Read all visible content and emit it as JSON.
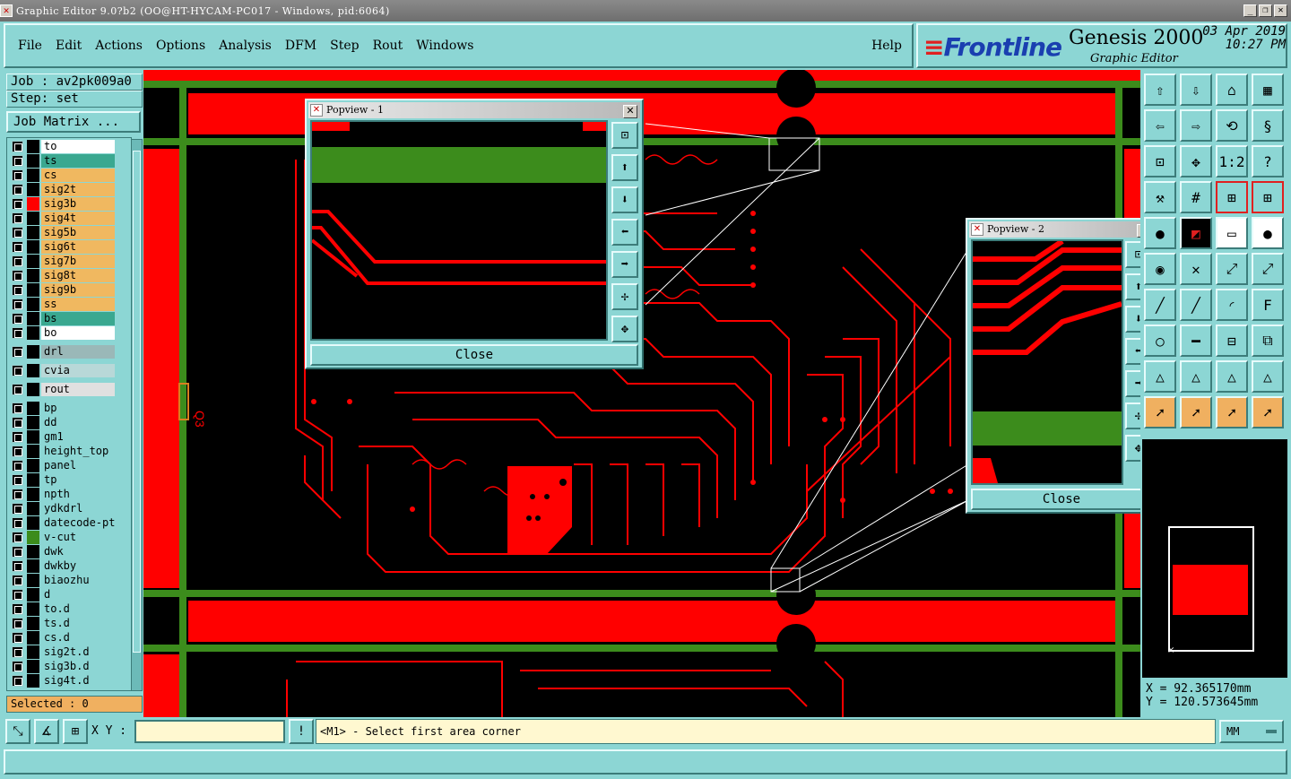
{
  "window": {
    "title": "Graphic Editor 9.0?b2 (OO@HT-HYCAM-PC017 - Windows, pid:6064)",
    "controls": [
      "minimize-icon",
      "restore-icon",
      "close-icon"
    ]
  },
  "menu": {
    "items": [
      "File",
      "Edit",
      "Actions",
      "Options",
      "Analysis",
      "DFM",
      "Step",
      "Rout",
      "Windows"
    ],
    "help": "Help"
  },
  "brand": {
    "logo": "Frontline",
    "product": "Genesis 2000",
    "subtitle": "Graphic Editor",
    "date": "03 Apr 2019",
    "time": "10:27 PM"
  },
  "job": {
    "job_label": "Job : av2pk009a0",
    "step_label": "Step: set",
    "matrix_button": "Job Matrix ..."
  },
  "layers": [
    {
      "name": "to",
      "color": "#ffffff",
      "mark": "#000000"
    },
    {
      "name": "ts",
      "color": "#3aa890",
      "mark": "#000000"
    },
    {
      "name": "cs",
      "color": "#f0b860",
      "mark": "#000000"
    },
    {
      "name": "sig2t",
      "color": "#f0b860",
      "mark": "#000000"
    },
    {
      "name": "sig3b",
      "color": "#f0b860",
      "mark": "#ff0000"
    },
    {
      "name": "sig4t",
      "color": "#f0b860",
      "mark": "#000000"
    },
    {
      "name": "sig5b",
      "color": "#f0b860",
      "mark": "#000000"
    },
    {
      "name": "sig6t",
      "color": "#f0b860",
      "mark": "#000000"
    },
    {
      "name": "sig7b",
      "color": "#f0b860",
      "mark": "#000000"
    },
    {
      "name": "sig8t",
      "color": "#f0b860",
      "mark": "#000000"
    },
    {
      "name": "sig9b",
      "color": "#f0b860",
      "mark": "#000000"
    },
    {
      "name": "ss",
      "color": "#f0b860",
      "mark": "#000000"
    },
    {
      "name": "bs",
      "color": "#3aa890",
      "mark": "#000000"
    },
    {
      "name": "bo",
      "color": "#ffffff",
      "mark": "#000000"
    },
    {
      "name": "drl",
      "color": "#9ab8b8",
      "mark": "#000000"
    },
    {
      "name": "cvia",
      "color": "#b8d8d8",
      "mark": "#000000"
    },
    {
      "name": "rout",
      "color": "#e0e0e0",
      "mark": "#000000"
    },
    {
      "name": "bp",
      "color": "#8cd6d4",
      "mark": "#000000"
    },
    {
      "name": "dd",
      "color": "#8cd6d4",
      "mark": "#000000"
    },
    {
      "name": "gm1",
      "color": "#8cd6d4",
      "mark": "#000000"
    },
    {
      "name": "height_top",
      "color": "#8cd6d4",
      "mark": "#000000"
    },
    {
      "name": "panel",
      "color": "#8cd6d4",
      "mark": "#000000"
    },
    {
      "name": "tp",
      "color": "#8cd6d4",
      "mark": "#000000"
    },
    {
      "name": "npth",
      "color": "#8cd6d4",
      "mark": "#000000"
    },
    {
      "name": "ydkdrl",
      "color": "#8cd6d4",
      "mark": "#000000"
    },
    {
      "name": "datecode-pte",
      "color": "#8cd6d4",
      "mark": "#000000"
    },
    {
      "name": "v-cut",
      "color": "#8cd6d4",
      "mark": "#3c8c1c"
    },
    {
      "name": "dwk",
      "color": "#8cd6d4",
      "mark": "#000000"
    },
    {
      "name": "dwkby",
      "color": "#8cd6d4",
      "mark": "#000000"
    },
    {
      "name": "biaozhu",
      "color": "#8cd6d4",
      "mark": "#000000"
    },
    {
      "name": "d",
      "color": "#8cd6d4",
      "mark": "#000000"
    },
    {
      "name": "to.d",
      "color": "#8cd6d4",
      "mark": "#000000"
    },
    {
      "name": "ts.d",
      "color": "#8cd6d4",
      "mark": "#000000"
    },
    {
      "name": "cs.d",
      "color": "#8cd6d4",
      "mark": "#000000"
    },
    {
      "name": "sig2t.d",
      "color": "#8cd6d4",
      "mark": "#000000"
    },
    {
      "name": "sig3b.d",
      "color": "#8cd6d4",
      "mark": "#000000"
    },
    {
      "name": "sig4t.d",
      "color": "#8cd6d4",
      "mark": "#000000"
    }
  ],
  "selected_label": "Selected : 0",
  "popview1": {
    "title": "Popview - 1",
    "close": "Close"
  },
  "popview2": {
    "title": "Popview - 2",
    "close": "Close"
  },
  "canvas": {
    "designator": "Q3"
  },
  "toolbar_labels": {
    "ratio": "1:2",
    "help": "?"
  },
  "coords": {
    "x": "X = 92.365170mm",
    "y": "Y = 120.573645mm"
  },
  "bottom": {
    "xy_label": "X Y :",
    "xy_value": "",
    "prompt": "<M1> - Select first area corner",
    "units": "MM",
    "status": ""
  },
  "colors": {
    "copper": "#ff0000",
    "border": "#3c8c1c",
    "background": "#000000",
    "panel": "#8cd6d4"
  }
}
